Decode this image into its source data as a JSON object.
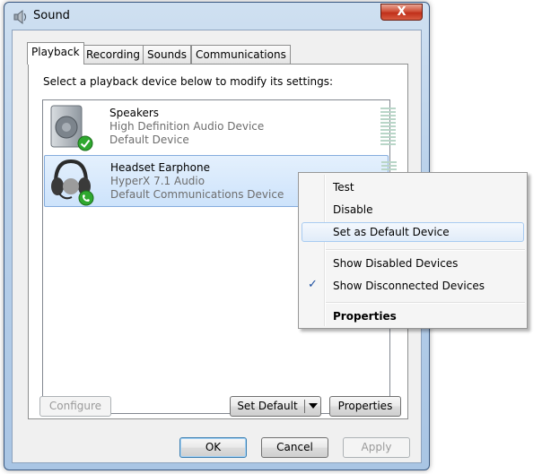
{
  "window": {
    "title": "Sound",
    "close_label": "X"
  },
  "tabs": [
    {
      "label": "Playback"
    },
    {
      "label": "Recording"
    },
    {
      "label": "Sounds"
    },
    {
      "label": "Communications"
    }
  ],
  "instruction": "Select a playback device below to modify its settings:",
  "devices": [
    {
      "name": "Speakers",
      "line1": "High Definition Audio Device",
      "line2": "Default Device"
    },
    {
      "name": "Headset Earphone",
      "line1": "HyperX 7.1 Audio",
      "line2": "Default Communications Device"
    }
  ],
  "buttons": {
    "configure": "Configure",
    "set_default": "Set Default",
    "properties": "Properties",
    "ok": "OK",
    "cancel": "Cancel",
    "apply": "Apply"
  },
  "context_menu": {
    "items": [
      {
        "label": "Test"
      },
      {
        "label": "Disable"
      },
      {
        "label": "Set as Default Device"
      },
      {
        "label": "Show Disabled Devices"
      },
      {
        "label": "Show Disconnected Devices",
        "checked": true
      },
      {
        "label": "Properties"
      }
    ],
    "check_glyph": "✓"
  },
  "colors": {
    "accent": "#3399ff",
    "default_badge": "#2fa82f"
  }
}
